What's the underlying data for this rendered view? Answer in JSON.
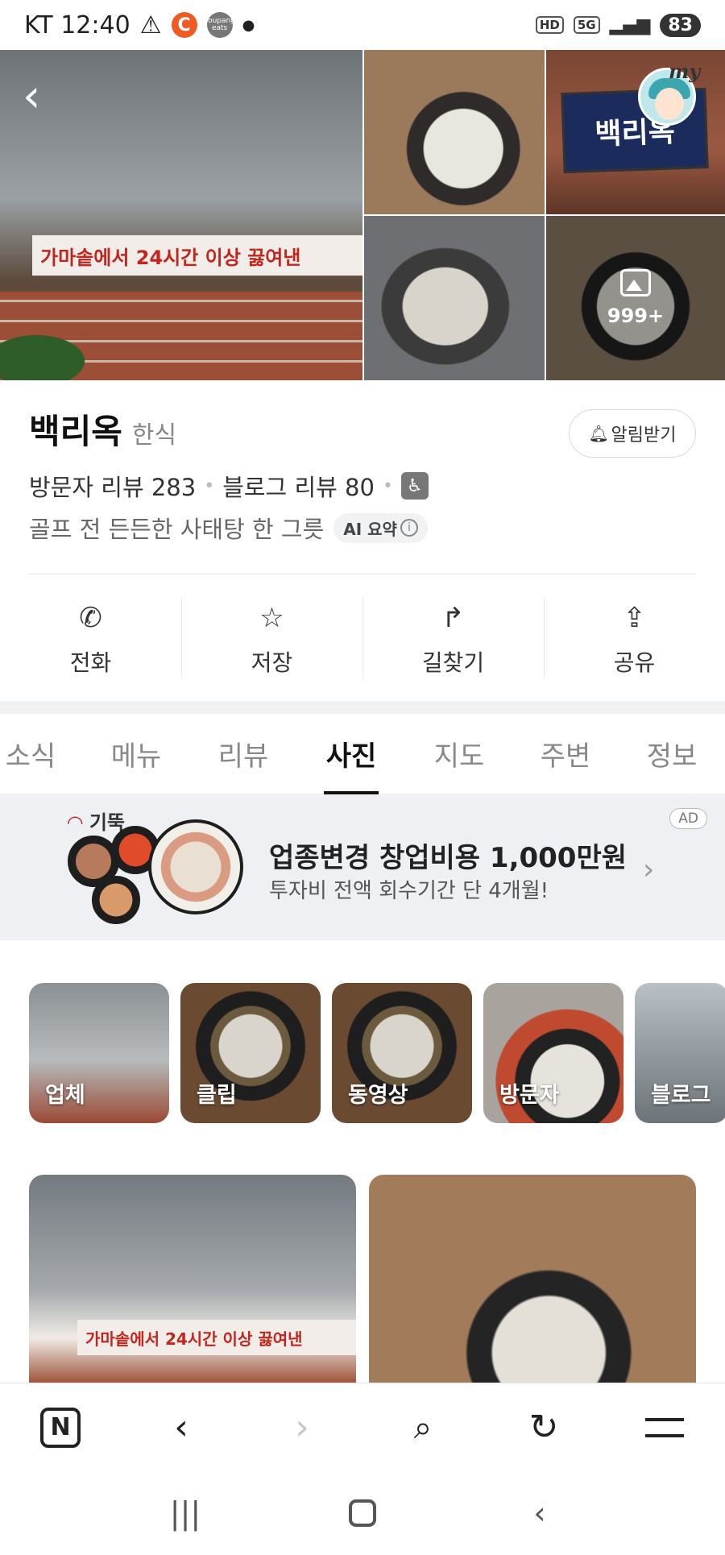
{
  "status_bar": {
    "carrier_time": "KT 12:40",
    "warning_icon": "warning-icon",
    "app_badge_c": "C",
    "app_badge_eats": "coupang eats",
    "hd": "HD",
    "network": "5G",
    "battery": "83"
  },
  "photos": {
    "main_banner_text": "가마솥에서 24시간 이상 끓여낸",
    "sign_text": "백리옥",
    "photo_count": "999+",
    "profile_label": "my"
  },
  "place": {
    "name": "백리옥",
    "category": "한식",
    "notify_label": "알림받기",
    "visitor_reviews": "방문자 리뷰 283",
    "blog_reviews": "블로그 리뷰 80",
    "description": "골프 전 든든한 사태탕 한 그릇",
    "ai_badge": "AI 요약"
  },
  "actions": [
    {
      "label": "전화",
      "icon": "phone-icon"
    },
    {
      "label": "저장",
      "icon": "star-icon"
    },
    {
      "label": "길찾기",
      "icon": "directions-icon"
    },
    {
      "label": "공유",
      "icon": "share-icon"
    }
  ],
  "tabs": [
    {
      "label": "소식",
      "active": false
    },
    {
      "label": "메뉴",
      "active": false
    },
    {
      "label": "리뷰",
      "active": false
    },
    {
      "label": "사진",
      "active": true
    },
    {
      "label": "지도",
      "active": false
    },
    {
      "label": "주변",
      "active": false
    },
    {
      "label": "정보",
      "active": false
    }
  ],
  "ad": {
    "brand": "기뚝",
    "title": "업종변경 창업비용 1,000만원",
    "subtitle": "투자비 전액 회수기간 단 4개월!",
    "badge": "AD"
  },
  "photo_categories": [
    {
      "label": "업체"
    },
    {
      "label": "클립"
    },
    {
      "label": "동영상"
    },
    {
      "label": "방문자"
    },
    {
      "label": "블로그"
    }
  ],
  "feed": {
    "first_banner_text": "가마솥에서 24시간 이상 끓여낸"
  },
  "browser_bar": {
    "home_logo": "N"
  }
}
